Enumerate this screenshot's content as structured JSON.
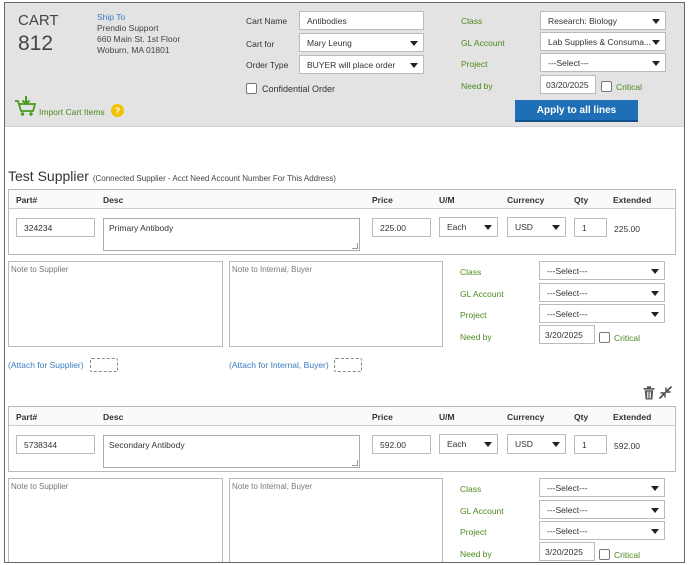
{
  "header": {
    "cart_label": "CART",
    "cart_number": "812",
    "ship_to_label": "Ship To",
    "ship_to_lines": [
      "Prendio Support",
      "660 Main St. 1st Floor",
      "Woburn, MA 01801"
    ],
    "cart_name_label": "Cart Name",
    "cart_name_value": "Antibodies",
    "cart_for_label": "Cart for",
    "cart_for_value": "Mary Leung",
    "order_type_label": "Order Type",
    "order_type_value": "BUYER will place order",
    "confidential_label": "Confidential Order",
    "class_label": "Class",
    "class_value": "Research: Biology",
    "gl_label": "GL Account",
    "gl_value": "Lab Supplies & Consuma...",
    "project_label": "Project",
    "project_value": "---Select---",
    "need_by_label": "Need by",
    "need_by_value": "03/20/2025",
    "critical_label": "Critical",
    "import_label": "Import Cart Items",
    "help_glyph": "?",
    "apply_label": "Apply to all lines"
  },
  "supplier": {
    "name": "Test Supplier",
    "note": "(Connected Supplier - Acct Need Account Number For This Address)"
  },
  "columns": {
    "part": "Part#",
    "desc": "Desc",
    "price": "Price",
    "um": "U/M",
    "currency": "Currency",
    "qty": "Qty",
    "extended": "Extended"
  },
  "lines": [
    {
      "part": "324234",
      "desc": "Primary Antibody",
      "price": "225.00",
      "um": "Each",
      "currency": "USD",
      "qty": "1",
      "extended": "225.00",
      "note_supplier_placeholder": "Note to Supplier",
      "note_internal_placeholder": "Note to Internal, Buyer",
      "class_label": "Class",
      "class_value": "---Select---",
      "gl_label": "GL Account",
      "gl_value": "---Select---",
      "project_label": "Project",
      "project_value": "---Select---",
      "need_by_label": "Need by",
      "need_by_value": "3/20/2025",
      "critical_label": "Critical",
      "attach_supplier": "(Attach for Supplier)",
      "attach_internal": "(Attach for Internal, Buyer)"
    },
    {
      "part": "5738344",
      "desc": "Secondary Antibody",
      "price": "592.00",
      "um": "Each",
      "currency": "USD",
      "qty": "1",
      "extended": "592.00",
      "note_supplier_placeholder": "Note to Supplier",
      "note_internal_placeholder": "Note to Internal, Buyer",
      "class_label": "Class",
      "class_value": "---Select---",
      "gl_label": "GL Account",
      "gl_value": "---Select---",
      "project_label": "Project",
      "project_value": "---Select---",
      "need_by_label": "Need by",
      "need_by_value": "3/20/2025",
      "critical_label": "Critical"
    }
  ],
  "icons": {
    "import": "cart-import-icon",
    "help": "help-icon",
    "delete": "trash-icon",
    "collapse": "collapse-arrows-icon"
  },
  "colors": {
    "header_bg": "#e3e3e3",
    "accent_blue": "#1f6fb7",
    "label_green": "#4a8a1e",
    "link_blue": "#3a7bbf",
    "help_yellow": "#f2c200"
  }
}
